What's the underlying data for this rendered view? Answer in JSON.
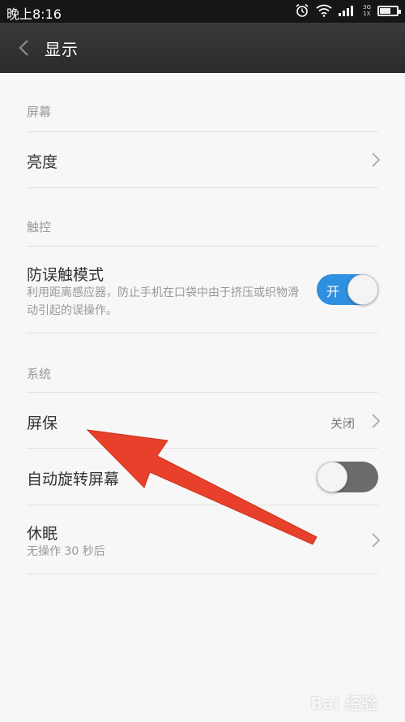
{
  "status_bar": {
    "time": "晚上8:16",
    "icons": [
      "alarm-icon",
      "wifi-icon",
      "signal-icon",
      "battery-icon"
    ],
    "network_top": "3G",
    "network_bottom": "1X"
  },
  "header": {
    "title": "显示"
  },
  "sections": {
    "screen": {
      "header": "屏幕",
      "brightness": {
        "title": "亮度"
      }
    },
    "touch": {
      "header": "触控",
      "anti_mistouch": {
        "title": "防误触模式",
        "description": "利用距离感应器，防止手机在口袋中由于挤压或织物滑动引起的误操作。",
        "switch_label": "开",
        "enabled": true
      }
    },
    "system": {
      "header": "系统",
      "screensaver": {
        "title": "屏保",
        "value": "关闭"
      },
      "auto_rotate": {
        "title": "自动旋转屏幕",
        "enabled": false
      },
      "sleep": {
        "title": "休眠",
        "description": "无操作 30 秒后"
      }
    }
  },
  "colors": {
    "accent": "#2f8fe0",
    "annotation_arrow": "#e8402a"
  },
  "watermark": "Bai 经验"
}
